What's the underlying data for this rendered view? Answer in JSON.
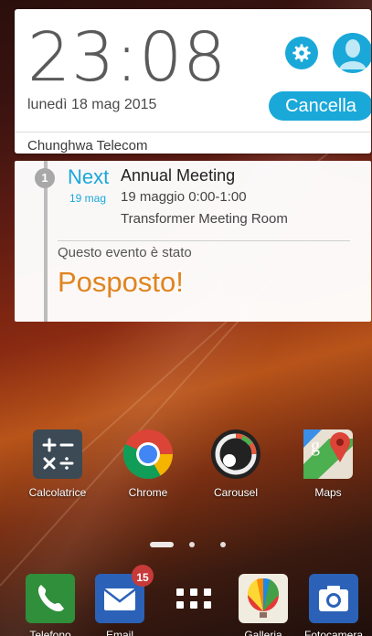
{
  "lock_notification": {
    "clock": "23:08",
    "date": "lunedì 18 mag 2015",
    "clear_label": "Cancella",
    "carrier": "Chunghwa Telecom"
  },
  "event_widget": {
    "badge": "1",
    "next_label": "Next",
    "date_short": "19 mag",
    "title": "Annual Meeting",
    "time": "19 maggio 0:00-1:00",
    "room": "Transformer Meeting Room",
    "note": "Questo evento è stato",
    "status": "Posposto!"
  },
  "apps": {
    "calculator": "Calcolatrice",
    "chrome": "Chrome",
    "carousel": "Carousel",
    "maps": "Maps"
  },
  "dock": {
    "phone": "Telefono",
    "email": "Email",
    "email_badge": "15",
    "gallery": "Galleria",
    "camera": "Fotocamera"
  },
  "colors": {
    "accent": "#1aa8d9",
    "status": "#e0841f",
    "badge": "#c63a3a"
  }
}
